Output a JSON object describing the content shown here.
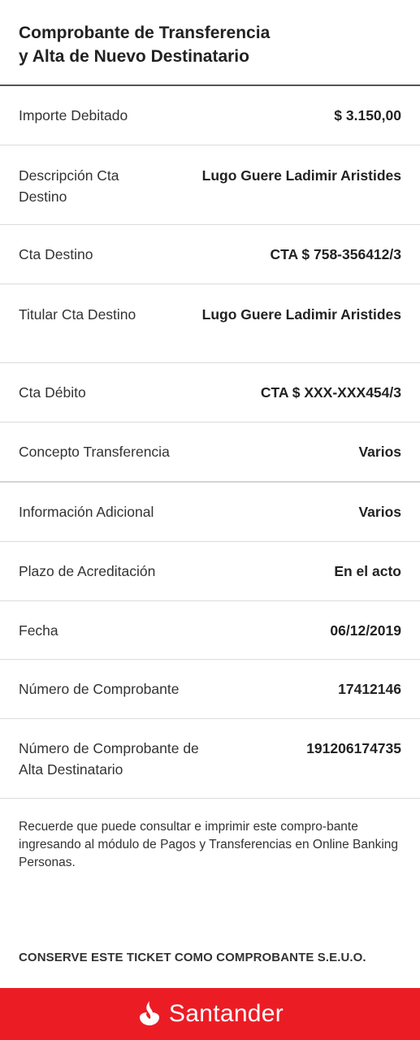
{
  "header": {
    "title": "Comprobante de Transferencia\ny Alta de Nuevo Destinatario"
  },
  "rows": [
    {
      "label": "Importe Debitado",
      "value": "$ 3.150,00"
    },
    {
      "label": "Descripción Cta Destino",
      "value": "Lugo Guere Ladimir Aristides"
    },
    {
      "label": "Cta Destino",
      "value": "CTA $ 758-356412/3"
    },
    {
      "label": "Titular Cta Destino",
      "value": "Lugo Guere Ladimir Aristides"
    },
    {
      "label": "Cta Débito",
      "value": "CTA $ XXX-XXX454/3"
    },
    {
      "label": "Concepto Transferencia",
      "value": "Varios"
    },
    {
      "label": "Información Adicional",
      "value": "Varios"
    },
    {
      "label": "Plazo de Acreditación",
      "value": "En el acto"
    },
    {
      "label": "Fecha",
      "value": "06/12/2019"
    },
    {
      "label": "Número de Comprobante",
      "value": "17412146"
    },
    {
      "label": "Número de Comprobante de Alta Destinatario",
      "value": "191206174735"
    }
  ],
  "note": "Recuerde que puede consultar e imprimir este compro-bante ingresando al módulo de Pagos y Transferencias en Online Banking Personas.",
  "ticket_notice": "CONSERVE ESTE TICKET COMO COMPROBANTE S.E.U.O.",
  "footer": {
    "brand": "Santander",
    "logo_icon": "santander-flame-icon",
    "color": "#ec1c24"
  }
}
